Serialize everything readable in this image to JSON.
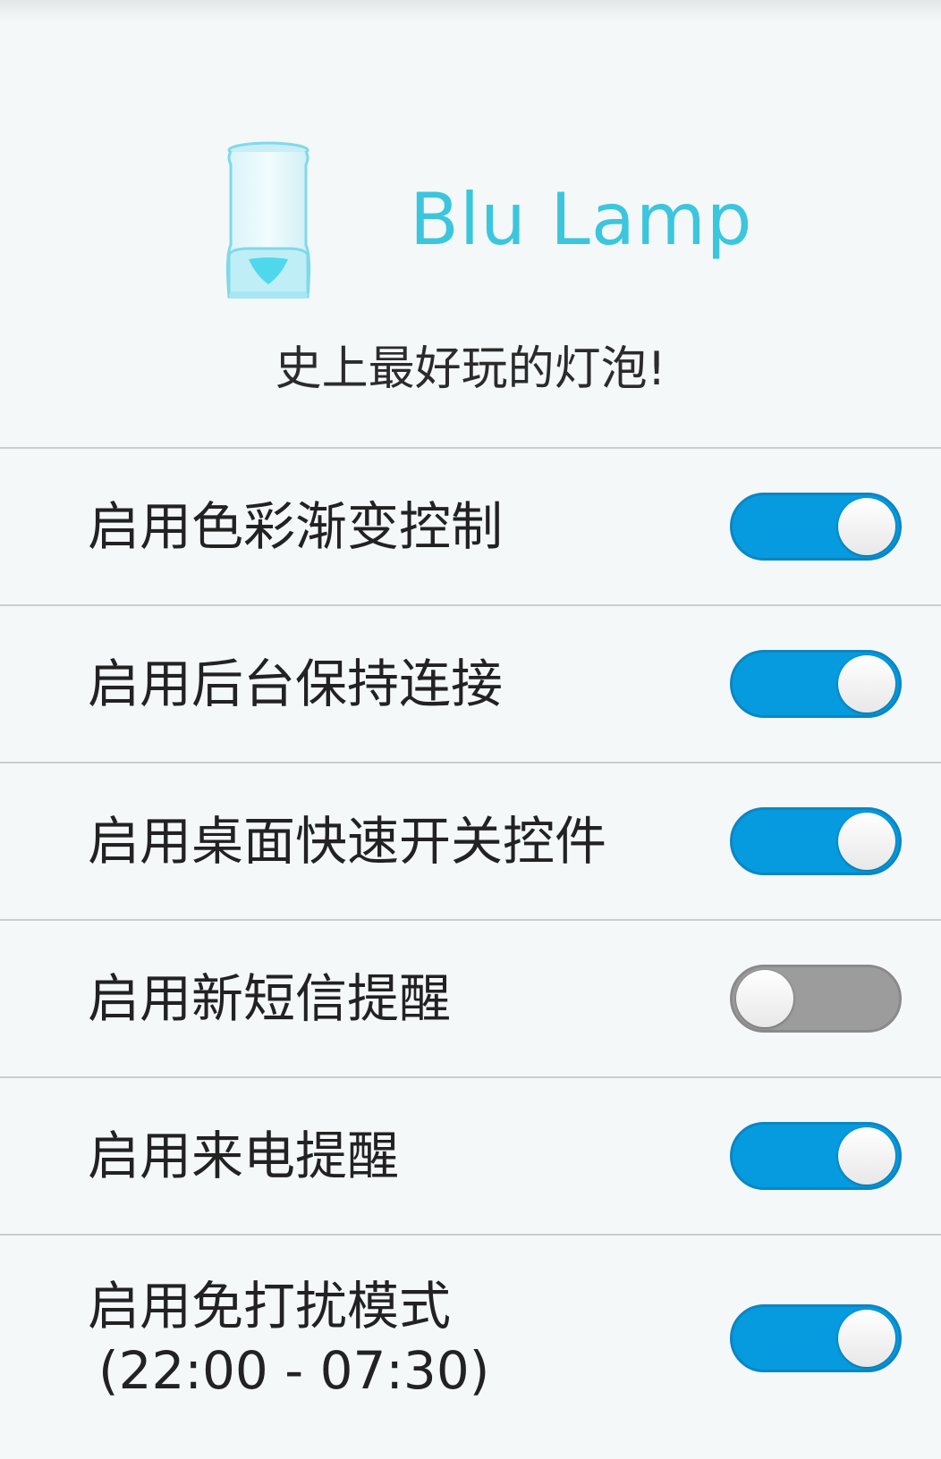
{
  "app": {
    "title": "Blu Lamp",
    "tagline": "史上最好玩的灯泡!",
    "accent_color": "#3cc6dd",
    "icon": "lamp-icon"
  },
  "settings": [
    {
      "label": "启用色彩渐变控制",
      "enabled": true
    },
    {
      "label": "启用后台保持连接",
      "enabled": true
    },
    {
      "label": "启用桌面快速开关控件",
      "enabled": true
    },
    {
      "label": "启用新短信提醒",
      "enabled": false
    },
    {
      "label": "启用来电提醒",
      "enabled": true
    },
    {
      "label": "启用免打扰模式",
      "sublabel": "(22:00 - 07:30)",
      "enabled": true
    }
  ],
  "colors": {
    "switch_on": "#069bdf",
    "switch_off": "#9c9c9c"
  }
}
